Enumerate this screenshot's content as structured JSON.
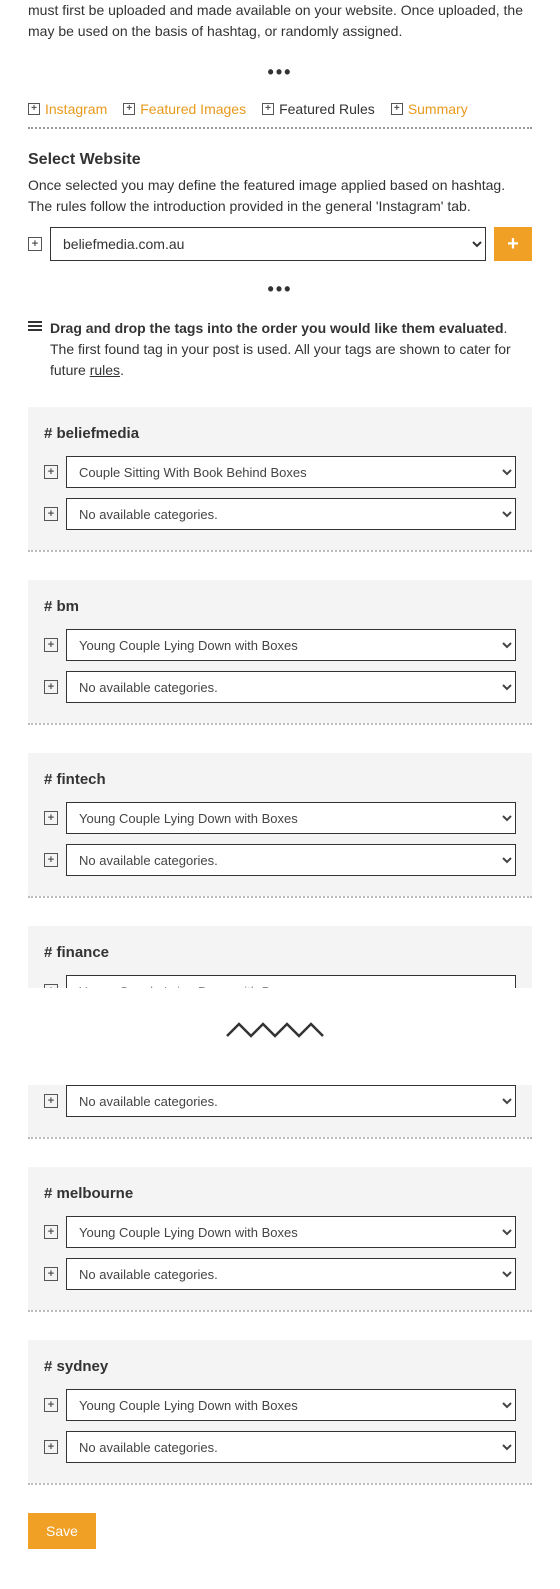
{
  "intro": "must first be uploaded and made available on your website. Once uploaded, the may be used on the basis of hashtag, or randomly assigned.",
  "tabs": {
    "instagram": "Instagram",
    "featured_images": "Featured Images",
    "featured_rules": "Featured Rules",
    "summary": "Summary"
  },
  "select_website": {
    "title": "Select Website",
    "desc": "Once selected you may define the featured image applied based on hashtag. The rules follow the introduction provided in the general 'Instagram' tab.",
    "option": "beliefmedia.com.au"
  },
  "instruction": {
    "bold": "Drag and drop the tags into the order you would like them evaluated",
    "rest": ". The first found tag in your post is used. All your tags are shown to cater for future ",
    "rules": "rules",
    "period": "."
  },
  "tags": {
    "beliefmedia": {
      "title": "# beliefmedia",
      "opt1": "Couple Sitting With Book Behind Boxes",
      "opt2": "No available categories."
    },
    "bm": {
      "title": "# bm",
      "opt1": "Young Couple Lying Down with Boxes",
      "opt2": "No available categories."
    },
    "fintech": {
      "title": "# fintech",
      "opt1": "Young Couple Lying Down with Boxes",
      "opt2": "No available categories."
    },
    "finance": {
      "title": "# finance",
      "opt1": "Young Couple Lying Down with Boxes"
    },
    "resume": {
      "opt2": "No available categories."
    },
    "melbourne": {
      "title": "# melbourne",
      "opt1": "Young Couple Lying Down with Boxes",
      "opt2": "No available categories."
    },
    "sydney": {
      "title": "# sydney",
      "opt1": "Young Couple Lying Down with Boxes",
      "opt2": "No available categories."
    }
  },
  "save": "Save"
}
